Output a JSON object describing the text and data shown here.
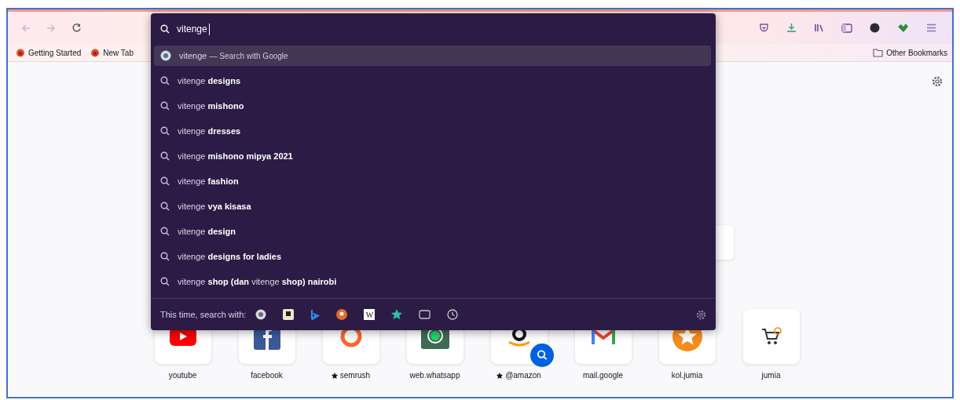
{
  "toolbar": {
    "back": {
      "disabled": true
    },
    "forward": {
      "disabled": true
    }
  },
  "bookmarks": [
    {
      "label": "Getting Started"
    },
    {
      "label": "New Tab"
    }
  ],
  "other_bookmarks": {
    "label": "Other Bookmarks"
  },
  "url_popup": {
    "query": "vitenge",
    "heuristic": {
      "term": "vitenge",
      "action": "— Search with Google",
      "selected": true
    },
    "suggestions": [
      {
        "text": "vitenge **designs**",
        "selected": false
      },
      {
        "text": "vitenge **mishono**",
        "selected": false
      },
      {
        "text": "vitenge **dresses**",
        "selected": false
      },
      {
        "text": "vitenge **mishono mipya 2021**",
        "selected": false
      },
      {
        "text": "vitenge **fashion**",
        "selected": false
      },
      {
        "text": "vitenge **vya kisasa**",
        "selected": false
      },
      {
        "text": "vitenge **design**",
        "selected": false
      },
      {
        "text": "vitenge **designs for ladies**",
        "selected": false
      },
      {
        "text": "vitenge **shop (dan** vitenge **shop) nairobi**",
        "selected": false
      }
    ],
    "footer_label": "This time, search with:",
    "engines": [
      {
        "kind": "google"
      },
      {
        "kind": "amazon"
      },
      {
        "kind": "bing"
      },
      {
        "kind": "duckduckgo"
      },
      {
        "kind": "wikipedia",
        "glyph": "W"
      },
      {
        "kind": "bookmarks"
      },
      {
        "kind": "tabs"
      },
      {
        "kind": "history"
      }
    ]
  },
  "top_sites": [
    {
      "label": "youtube",
      "kind": "youtube",
      "pinned": false,
      "search_shortcut": false
    },
    {
      "label": "facebook",
      "kind": "facebook",
      "pinned": false,
      "search_shortcut": false
    },
    {
      "label": "semrush",
      "kind": "semrush",
      "pinned": true,
      "search_shortcut": false
    },
    {
      "label": "web.whatsapp",
      "kind": "whatsapp",
      "pinned": false,
      "search_shortcut": false
    },
    {
      "label": "@amazon",
      "kind": "amazon",
      "pinned": true,
      "search_shortcut": true
    },
    {
      "label": "mail.google",
      "kind": "gmail",
      "pinned": false,
      "search_shortcut": false
    },
    {
      "label": "kol.jumia",
      "kind": "koljumia",
      "pinned": false,
      "search_shortcut": false
    },
    {
      "label": "jumia",
      "kind": "jumia",
      "pinned": false,
      "search_shortcut": false
    }
  ]
}
